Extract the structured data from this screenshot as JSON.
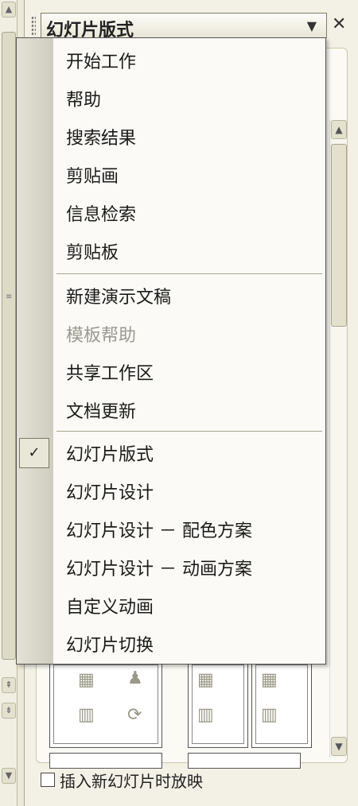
{
  "task_pane": {
    "title": "幻灯片版式",
    "dropdown_icon": "triangle-down-icon",
    "close_icon": "close-icon",
    "checkbox_label": "插入新幻灯片时放映"
  },
  "menu": {
    "group1": [
      {
        "label": "开始工作"
      },
      {
        "label": "帮助"
      },
      {
        "label": "搜索结果"
      },
      {
        "label": "剪贴画"
      },
      {
        "label": "信息检索"
      },
      {
        "label": "剪贴板"
      }
    ],
    "group2": [
      {
        "label": "新建演示文稿"
      },
      {
        "label": "模板帮助",
        "disabled": true
      },
      {
        "label": "共享工作区"
      },
      {
        "label": "文档更新"
      }
    ],
    "group3": [
      {
        "label": "幻灯片版式",
        "checked": true
      },
      {
        "label": "幻灯片设计"
      },
      {
        "label": "幻灯片设计 － 配色方案"
      },
      {
        "label": "幻灯片设计 － 动画方案"
      },
      {
        "label": "自定义动画"
      },
      {
        "label": "幻灯片切换"
      }
    ]
  }
}
